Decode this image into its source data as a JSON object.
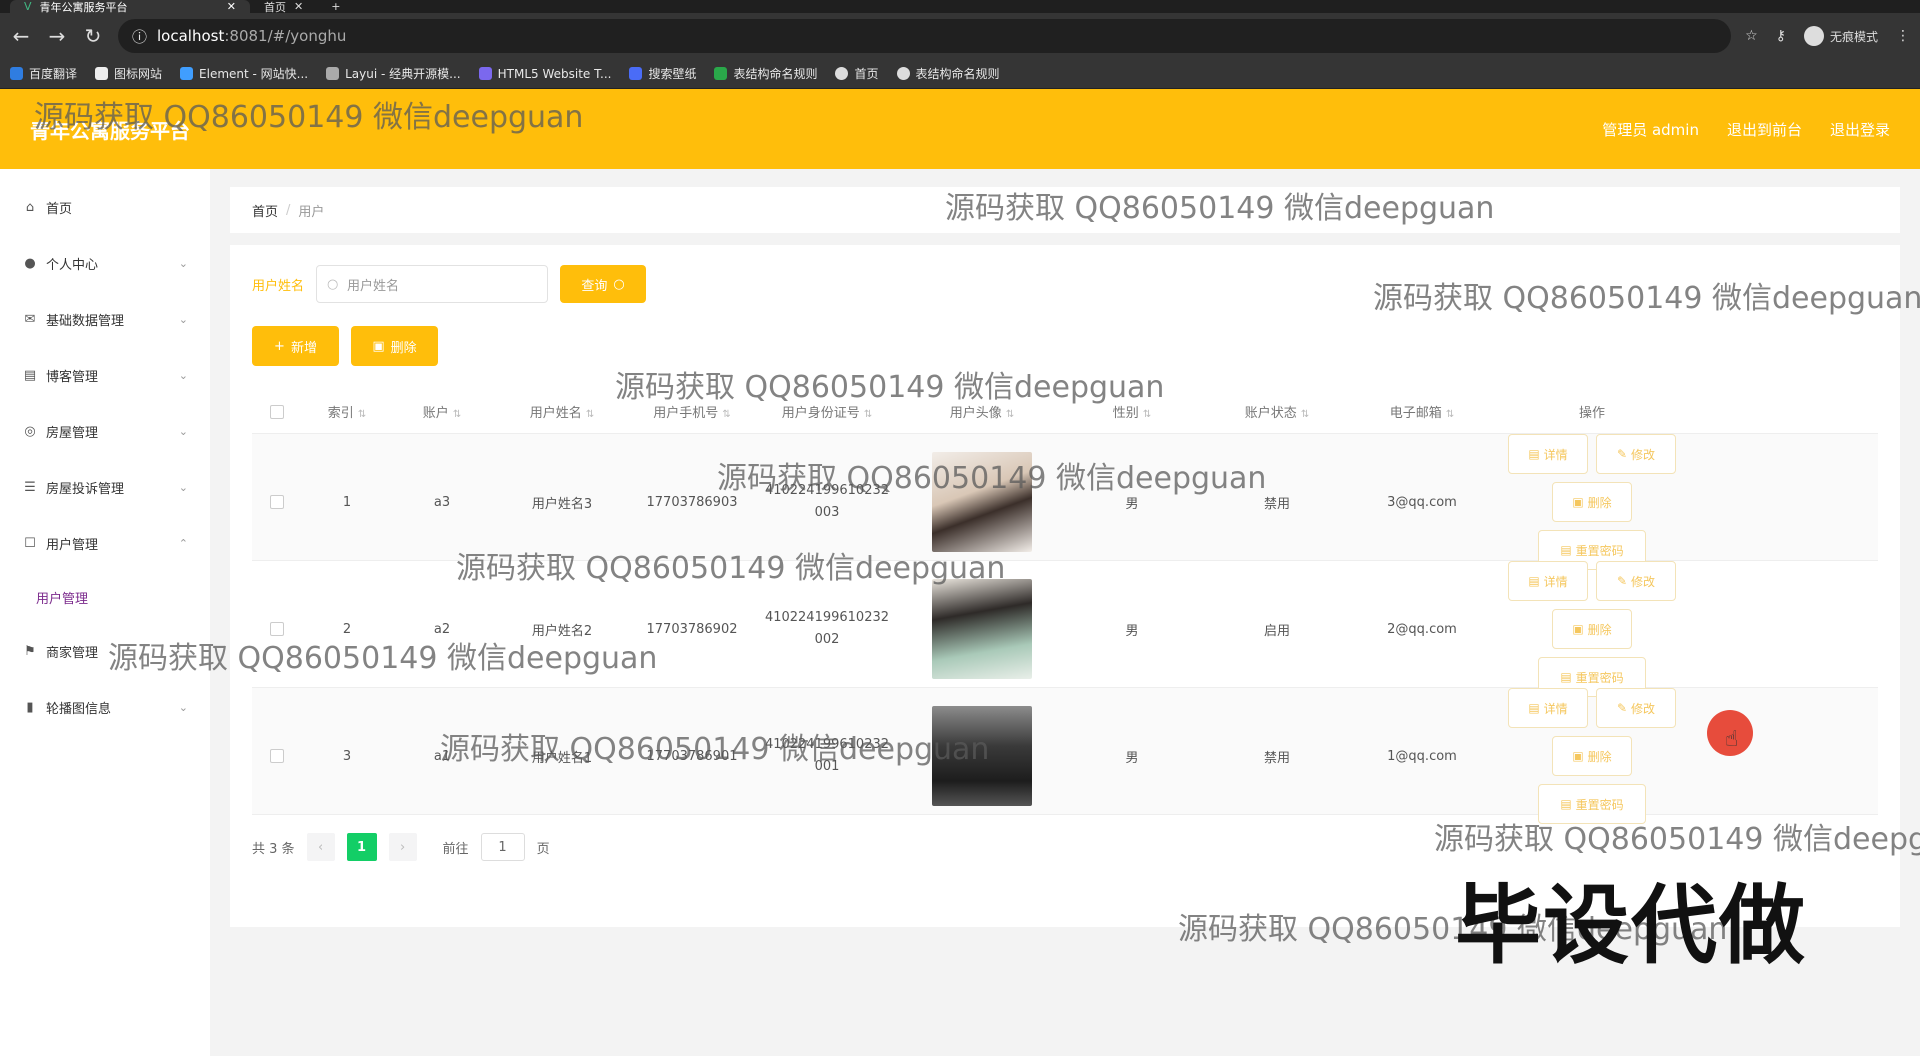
{
  "browser": {
    "tabs": [
      {
        "label": "青年公寓服务平台"
      },
      {
        "label": "首页"
      }
    ],
    "url_host": "localhost",
    "url_path": ":8081/#/yonghu",
    "profile_label": "无痕模式",
    "bookmarks": [
      "百度翻译",
      "图标网站",
      "Element - 网站快...",
      "Layui - 经典开源模...",
      "HTML5 Website T...",
      "搜索壁纸",
      "表结构命名规则",
      "首页",
      "表结构命名规则"
    ]
  },
  "header": {
    "title": "青年公寓服务平台",
    "links": [
      "管理员 admin",
      "退出到前台",
      "退出登录"
    ]
  },
  "sidebar": {
    "items": [
      {
        "label": "首页",
        "icon": "home-icon"
      },
      {
        "label": "个人中心",
        "icon": "user-icon"
      },
      {
        "label": "基础数据管理",
        "icon": "mail-icon"
      },
      {
        "label": "博客管理",
        "icon": "doc-icon"
      },
      {
        "label": "房屋管理",
        "icon": "globe-icon"
      },
      {
        "label": "房屋投诉管理",
        "icon": "sliders-icon"
      },
      {
        "label": "用户管理",
        "icon": "square-icon"
      }
    ],
    "sub_item": "用户管理",
    "items_after": [
      {
        "label": "商家管理",
        "icon": "flag-icon"
      },
      {
        "label": "轮播图信息",
        "icon": "chart-icon"
      }
    ]
  },
  "breadcrumb": {
    "home": "首页",
    "separator": "/",
    "current": "用户"
  },
  "search": {
    "label": "用户姓名",
    "placeholder": "用户姓名",
    "query_label": "查询"
  },
  "actions": {
    "add_label": "新增",
    "delete_label": "删除"
  },
  "table": {
    "headers": [
      "索引",
      "账户",
      "用户姓名",
      "用户手机号",
      "用户身份证号",
      "用户头像",
      "性别",
      "账户状态",
      "电子邮箱",
      "操作"
    ],
    "rows": [
      {
        "index": "1",
        "account": "a3",
        "name": "用户姓名3",
        "phone": "17703786903",
        "id_line1": "410224199610232",
        "id_line2": "003",
        "gender": "男",
        "status": "禁用",
        "email": "3@qq.com"
      },
      {
        "index": "2",
        "account": "a2",
        "name": "用户姓名2",
        "phone": "17703786902",
        "id_line1": "410224199610232",
        "id_line2": "002",
        "gender": "男",
        "status": "启用",
        "email": "2@qq.com"
      },
      {
        "index": "3",
        "account": "a1",
        "name": "用户姓名1",
        "phone": "17703786901",
        "id_line1": "410224199610232",
        "id_line2": "001",
        "gender": "男",
        "status": "禁用",
        "email": "1@qq.com"
      }
    ],
    "op_labels": {
      "detail": "详情",
      "edit": "修改",
      "delete": "删除",
      "reset": "重置密码"
    }
  },
  "pager": {
    "total": "共 3 条",
    "prev": "‹",
    "page": "1",
    "next": "›",
    "goto": "前往",
    "goto_value": "1",
    "unit": "页"
  },
  "watermark": {
    "text": "源码获取 QQ86050149 微信deepguan",
    "big": "毕设代做"
  },
  "colors": {
    "accent": "#ffbe0b",
    "page_active": "#13ce66"
  }
}
